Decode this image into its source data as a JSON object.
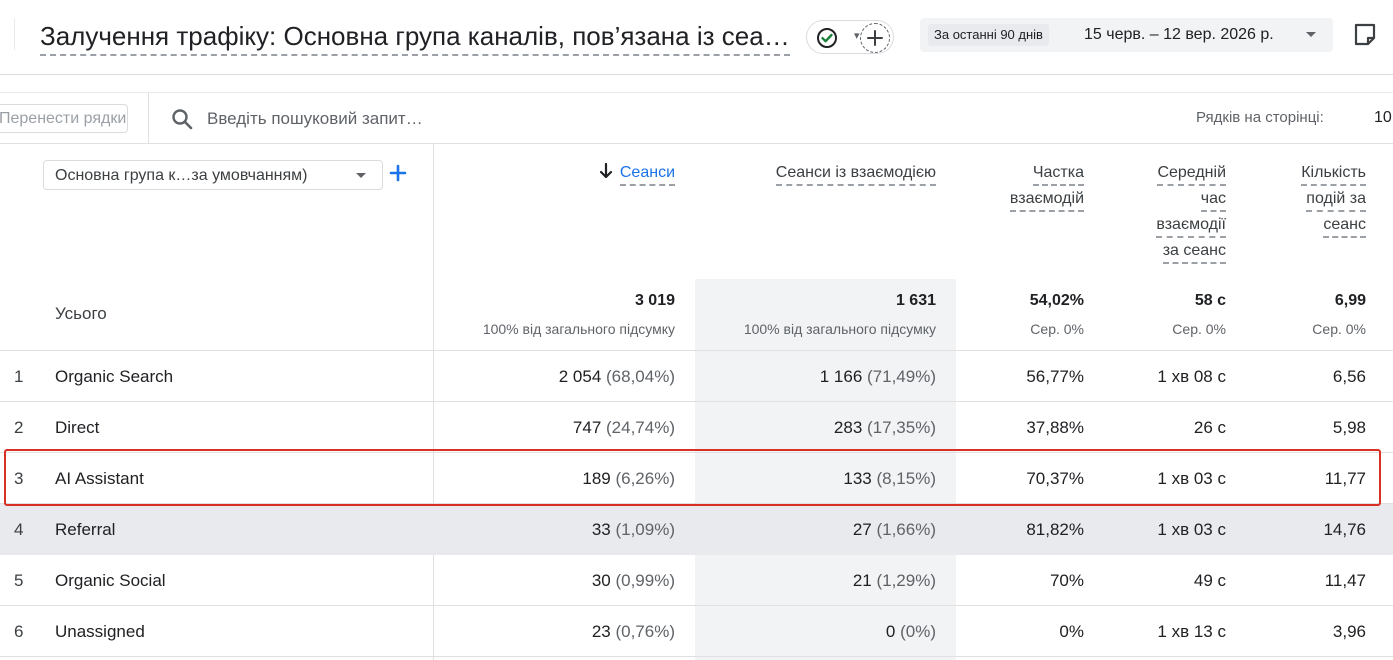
{
  "header": {
    "title": "Залучення трафіку: Основна група каналів, пов’язана із сеансом (за умовчанням)",
    "date_chip": "За останні 90 днів",
    "date_range": "15 черв. – 12 вер. 2026 р."
  },
  "toolbar": {
    "rows_filter_placeholder": "Перенести рядки",
    "search_placeholder": "Введіть пошуковий запит…",
    "rows_per_page_label": "Рядків на сторінці:",
    "rows_per_page_value": "10"
  },
  "table": {
    "dimension_select_label": "Основна група к…за умовчанням)",
    "headers": {
      "sessions": "Сеанси",
      "engaged_sessions": "Сеанси із взаємодією",
      "engagement_rate_1": "Частка",
      "engagement_rate_2": "взаємодій",
      "avg_time_1": "Середній",
      "avg_time_2": "час",
      "avg_time_3": "взаємодії",
      "avg_time_4": "за сеанс",
      "events_1": "Кількість",
      "events_2": "подій за",
      "events_3": "сеанс"
    },
    "totals": {
      "label": "Усього",
      "sessions": "3 019",
      "sessions_sub": "100% від загального підсумку",
      "engaged": "1 631",
      "engaged_sub": "100% від загального підсумку",
      "rate": "54,02%",
      "rate_sub": "Сер. 0%",
      "time": "58 с",
      "time_sub": "Сер. 0%",
      "events": "6,99",
      "events_sub": "Сер. 0%"
    },
    "rows": [
      {
        "num": "1",
        "name": "Organic Search",
        "sessions": "2 054",
        "sessions_pct": "(68,04%)",
        "engaged": "1 166",
        "engaged_pct": "(71,49%)",
        "rate": "56,77%",
        "time": "1 хв 08 с",
        "events": "6,56"
      },
      {
        "num": "2",
        "name": "Direct",
        "sessions": "747",
        "sessions_pct": "(24,74%)",
        "engaged": "283",
        "engaged_pct": "(17,35%)",
        "rate": "37,88%",
        "time": "26 с",
        "events": "5,98"
      },
      {
        "num": "3",
        "name": "AI Assistant",
        "sessions": "189",
        "sessions_pct": "(6,26%)",
        "engaged": "133",
        "engaged_pct": "(8,15%)",
        "rate": "70,37%",
        "time": "1 хв 03 с",
        "events": "11,77"
      },
      {
        "num": "4",
        "name": "Referral",
        "sessions": "33",
        "sessions_pct": "(1,09%)",
        "engaged": "27",
        "engaged_pct": "(1,66%)",
        "rate": "81,82%",
        "time": "1 хв 03 с",
        "events": "14,76"
      },
      {
        "num": "5",
        "name": "Organic Social",
        "sessions": "30",
        "sessions_pct": "(0,99%)",
        "engaged": "21",
        "engaged_pct": "(1,29%)",
        "rate": "70%",
        "time": "49 с",
        "events": "11,47"
      },
      {
        "num": "6",
        "name": "Unassigned",
        "sessions": "23",
        "sessions_pct": "(0,76%)",
        "engaged": "0",
        "engaged_pct": "(0%)",
        "rate": "0%",
        "time": "1 хв 13 с",
        "events": "3,96"
      }
    ]
  },
  "colors": {
    "accent": "#1a73e8",
    "highlight_border": "#d93025",
    "success": "#188038"
  }
}
